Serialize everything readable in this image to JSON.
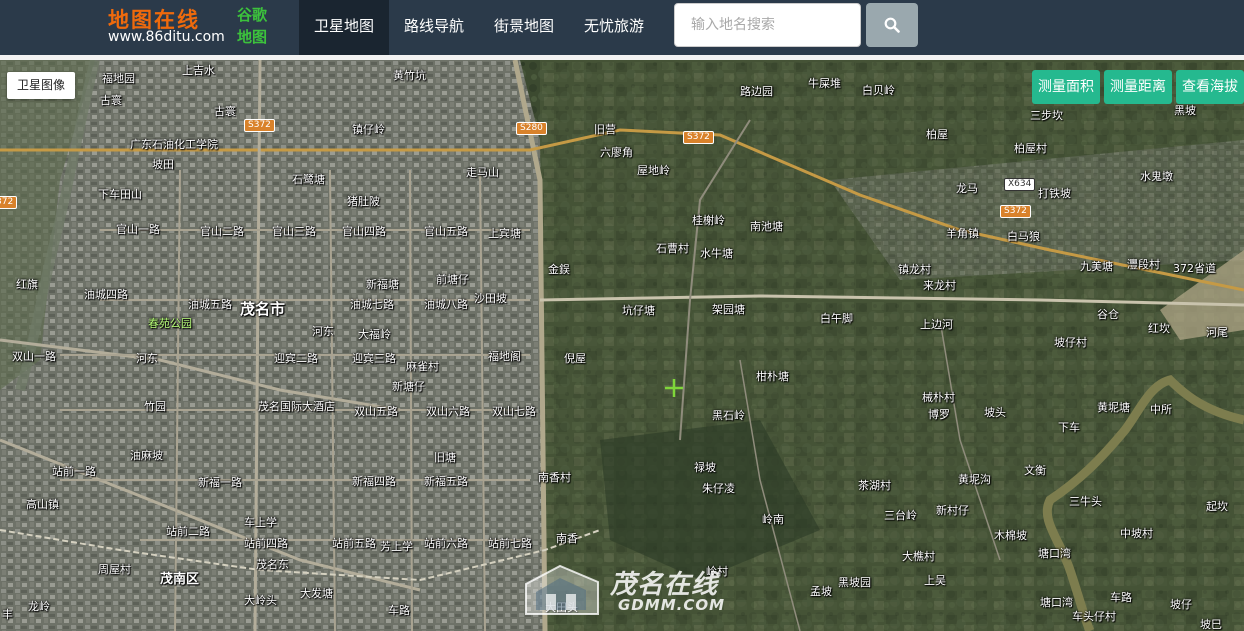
{
  "logo": {
    "main": "地图在线",
    "url": "www.86ditu.com",
    "sub": "谷歌地图"
  },
  "nav": [
    {
      "label": "卫星地图",
      "active": true
    },
    {
      "label": "路线导航",
      "active": false
    },
    {
      "label": "街景地图",
      "active": false
    },
    {
      "label": "无忧旅游",
      "active": false
    }
  ],
  "search": {
    "placeholder": "输入地名搜索",
    "value": "",
    "icon": "search-icon"
  },
  "map_controls": {
    "satellite_label": "卫星图像",
    "tools": [
      "测量面积",
      "测量距离",
      "查看海拔"
    ]
  },
  "watermark": {
    "text": "茂名在线",
    "sub": "GDMM.COM"
  },
  "road_shields": [
    "S372",
    "S280",
    "S372",
    "X634",
    "S372",
    "372"
  ],
  "labels": [
    "福地园",
    "上吉水",
    "黄竹坑",
    "牛屎堆",
    "白贝岭",
    "路边园",
    "古寰",
    "古寰",
    "镇仔岭",
    "旧营",
    "柏屋",
    "三步坎",
    "广东石油化工学院",
    "六廖角",
    "屋地岭",
    "柏屋村",
    "黑坡",
    "坡田",
    "下车田山",
    "石鹭塘",
    "走马山",
    "龙马",
    "打铁坡",
    "水鬼墩",
    "猪肚陂",
    "桂榭岭",
    "南池塘",
    "羊角镇",
    "白马狼",
    "官山一路",
    "官山二路",
    "官山三路",
    "官山四路",
    "官山五路",
    "上宾塘",
    "石曹村",
    "水牛塘",
    "镇龙村",
    "九美塘",
    "灃段村",
    "372省道",
    "红旗",
    "油城四路",
    "新福塘",
    "前塘仔",
    "金鋘",
    "来龙村",
    "谷仓",
    "油城五路",
    "油城七路",
    "油城八路",
    "沙田坡",
    "坑仔塘",
    "架园塘",
    "白午脚",
    "上边河",
    "红坎",
    "河尾",
    "春苑公园",
    "茂名市",
    "河东",
    "大福岭",
    "坡仔村",
    "双山一路",
    "河东",
    "迎宾二路",
    "迎宾三路",
    "麻雀村",
    "福地阁",
    "倪屋",
    "柑朴塘",
    "新塘仔",
    "械朴村",
    "竹园",
    "茂名国际大酒店",
    "双山五路",
    "双山六路",
    "双山七路",
    "博罗",
    "坡头",
    "黄坭塘",
    "中所",
    "黑石岭",
    "下车",
    "油麻坡",
    "旧塘",
    "禄坡",
    "文衡",
    "新福四路",
    "新福五路",
    "南香村",
    "朱仔凌",
    "茶湖村",
    "黄坭沟",
    "三牛头",
    "起坎",
    "高山镇",
    "站前一路",
    "新福一路",
    "站前二路",
    "车上学",
    "三台岭",
    "新村仔",
    "岭南",
    "站前四路",
    "站前五路",
    "站前六路",
    "站前七路",
    "南香",
    "木棉坡",
    "中坡村",
    "周屋村",
    "茂名东",
    "芳上学",
    "大樵村",
    "塘口湾",
    "茂南区",
    "岭村",
    "上吴",
    "大岭头",
    "大发塘",
    "孟坡",
    "黑坡园",
    "坡仔",
    "大田头",
    "车路",
    "龙岭",
    "丰",
    "车头仔村",
    "坡巳",
    "塘口湾",
    "车路"
  ]
}
